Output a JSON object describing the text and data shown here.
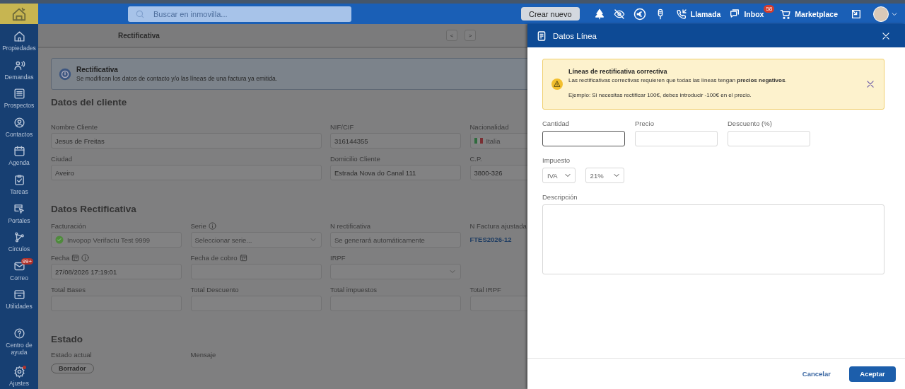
{
  "topbar": {
    "search": {
      "placeholder": "Buscar en inmovilla..."
    },
    "create_button": "Crear nuevo",
    "actions": [
      {
        "kind": "call",
        "label": "Llamada"
      },
      {
        "kind": "inbox",
        "label": "Inbox",
        "badge": "58"
      },
      {
        "kind": "cart",
        "label": "Marketplace"
      }
    ]
  },
  "sidebar": {
    "items": [
      {
        "kind": "home",
        "label": "Propiedades"
      },
      {
        "kind": "demand",
        "label": "Demandas"
      },
      {
        "kind": "list",
        "label": "Prospectos"
      },
      {
        "kind": "contact",
        "label": "Contactos"
      },
      {
        "kind": "calendar",
        "label": "Agenda"
      },
      {
        "kind": "task",
        "label": "Tareas"
      },
      {
        "kind": "portal",
        "label": "Portales"
      },
      {
        "kind": "circles",
        "label": "Circulos"
      },
      {
        "kind": "mail",
        "label": "Correo",
        "badge": "99+"
      },
      {
        "kind": "box",
        "label": "Utilidades"
      }
    ],
    "bottom_items": [
      {
        "kind": "help",
        "label": "Centro de ayuda",
        "alert": false
      },
      {
        "kind": "gear",
        "label": "Ajustes",
        "alert": true
      }
    ]
  },
  "page": {
    "breadcrumb": {
      "current": "Rectificativa"
    },
    "nav_buttons": [
      "<",
      ">"
    ],
    "notice": {
      "title": "Rectificativa",
      "text": "Se modifican los datos de contacto y/o las líneas de una factura ya emitida."
    },
    "sections": [
      {
        "title": "Datos del cliente",
        "rows": [
          [
            {
              "kind": "input",
              "label": "Nombre Cliente",
              "value": "Jesus de Freitas",
              "wide": true
            },
            {
              "kind": "input",
              "label": "NIF/CIF",
              "value": "316144355"
            },
            {
              "kind": "country",
              "label": "Nacionalidad",
              "value": "Italia"
            }
          ],
          [
            {
              "kind": "input",
              "label": "Ciudad",
              "value": "Aveiro",
              "wide": true
            },
            {
              "kind": "input",
              "label": "Domicilio Cliente",
              "value": "Estrada Nova do Canal 111"
            },
            {
              "kind": "input",
              "label": "C.P.",
              "value": "3800-326"
            }
          ]
        ]
      },
      {
        "title": "Datos Rectificativa",
        "rows": [
          [
            {
              "kind": "status",
              "label": "Facturación",
              "value": "Invopop Verifactu Test 9999",
              "disabled": true
            },
            {
              "kind": "select",
              "label": "Serie",
              "info_icon": true,
              "placeholder": "Seleccionar serie..."
            },
            {
              "kind": "input",
              "label": "N rectificativa",
              "placeholder": "Se generará automáticamente"
            },
            {
              "kind": "link",
              "label": "N Factura ajustada",
              "value": "FTES2026-12"
            }
          ],
          [
            {
              "kind": "input",
              "label": "Fecha",
              "calendar_icon": true,
              "info_icon": true,
              "value": "27/08/2026 17:19:01"
            },
            {
              "kind": "input",
              "label": "Fecha de cobro",
              "calendar_icon": true
            },
            {
              "kind": "select",
              "label": "IRPF"
            }
          ],
          [
            {
              "kind": "input",
              "label": "Total Bases"
            },
            {
              "kind": "input",
              "label": "Total Descuento"
            },
            {
              "kind": "input",
              "label": "Total impuestos"
            },
            {
              "kind": "input",
              "label": "Total IRPF"
            }
          ]
        ]
      },
      {
        "title": "Estado",
        "rows": [
          [
            {
              "kind": "chip",
              "label": "Estado actual",
              "value": "Borrador"
            },
            {
              "kind": "label",
              "label": "Mensaje"
            }
          ]
        ]
      }
    ]
  },
  "drawer": {
    "title": "Datos Línea",
    "alert": {
      "title": "Líneas de rectificativa correctiva",
      "text": "Las rectificativas correctivas requieren que todas las líneas tengan **precios negativos**.",
      "example": "Ejemplo: Si necesitas rectificar 100€, debes introducir -100€ en el precio."
    },
    "rows": [
      [
        {
          "kind": "input",
          "label": "Cantidad",
          "focused": true
        },
        {
          "kind": "input",
          "label": "Precio",
          "focused": false
        },
        {
          "kind": "input",
          "label": "Descuento (%)",
          "focused": false
        }
      ],
      [
        {
          "kind": "selects",
          "label": "Impuesto",
          "values": [
            "IVA",
            "21%"
          ]
        }
      ],
      [
        {
          "kind": "textarea",
          "label": "Descripción"
        }
      ]
    ],
    "buttons": [
      {
        "kind": "text",
        "label": "Cancelar"
      },
      {
        "kind": "primary",
        "label": "Aceptar"
      }
    ]
  }
}
